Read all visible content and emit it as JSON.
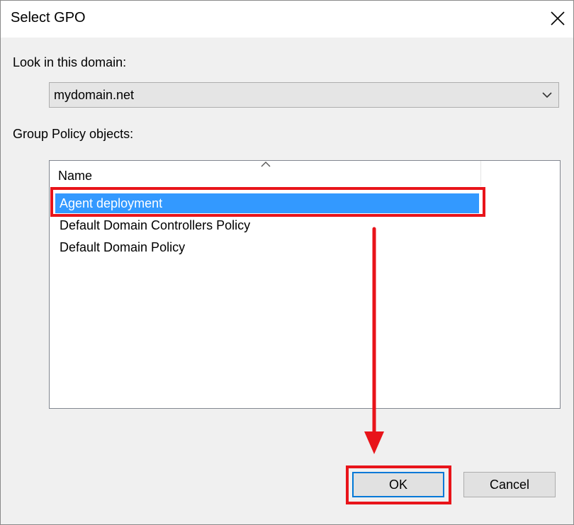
{
  "dialog": {
    "title": "Select GPO",
    "close_icon": "close-icon"
  },
  "domain_section": {
    "label": "Look in this domain:",
    "selected_domain": "mydomain.net",
    "dropdown_icon": "chevron-down-icon"
  },
  "gpo_section": {
    "label": "Group Policy objects:",
    "column_header": "Name",
    "sort_icon": "sort-ascending-icon",
    "items": [
      {
        "name": "Agent deployment",
        "selected": true
      },
      {
        "name": "Default Domain Controllers Policy",
        "selected": false
      },
      {
        "name": "Default Domain Policy",
        "selected": false
      }
    ]
  },
  "buttons": {
    "ok_label": "OK",
    "cancel_label": "Cancel"
  },
  "annotations": {
    "highlight_color": "#e8141a",
    "arrow_icon": "down-arrow-icon"
  },
  "colors": {
    "selection": "#3399ff",
    "default_button_border": "#0078d7"
  }
}
